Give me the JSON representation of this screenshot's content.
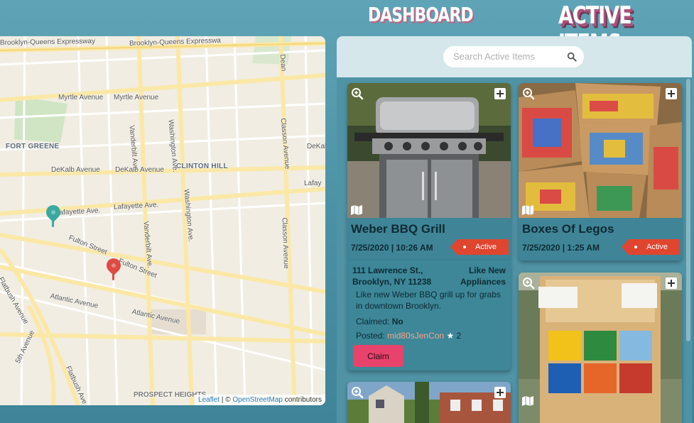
{
  "nav": {
    "dashboard": "DASHBOARD",
    "active_items": "ACTIVE ITEMS"
  },
  "map": {
    "labels": {
      "bqe_1": "Brooklyn-Queens Expressway",
      "bqe_2": "Brooklyn-Queens Expresswa",
      "myrtle_1": "Myrtle Avenue",
      "myrtle_2": "Myrtle Avenue",
      "fort_greene": "FORT GREENE",
      "dekalb_1": "DeKalb Avenue",
      "dekalb_2": "DeKalb Avenue",
      "clinton_hill": "CLINTON HILL",
      "dekalb_3": "DeKalb",
      "lafayette_1": "Lafayette Ave.",
      "lafayette_2": "Lafayette Ave.",
      "lafayette_3": "Lafay",
      "fulton_1": "Fulton Street",
      "fulton_2": "Fulton Street",
      "atlantic_1": "Atlantic Avenue",
      "atlantic_2": "Atlantic Avenue",
      "vanderbilt_1": "Vanderbilt Ave.",
      "vanderbilt_2": "Vanderbilt Ave.",
      "washington_1": "Washington Ave.",
      "washington_2": "Washington Ave.",
      "classon_1": "Classon Avenue",
      "classon_2": "Classon Avenue",
      "flatbush_1": "Flatbush Avenue",
      "flatbush_2": "Flatbush Ave",
      "fifth_ave": "5th Avenue",
      "prospect_heights": "PROSPECT HEIGHTS",
      "dean": "Dean"
    },
    "attribution": {
      "leaflet": "Leaflet",
      "sep": " | © ",
      "osm": "OpenStreetMap",
      "contrib": " contributors"
    },
    "pins": {
      "teal": "#3aa9a0",
      "red": "#e04a44"
    }
  },
  "search": {
    "placeholder": "Search Active Items"
  },
  "cards": [
    {
      "title": "Weber BBQ Grill",
      "date": "7/25/2020 | 10:26 AM",
      "status": "Active",
      "address_line1": "111 Lawrence St.,",
      "address_line2": "Brooklyn, NY 11238",
      "condition_line1": "Like New",
      "condition_line2": "Appliances",
      "description": "Like new Weber BBQ grill up for grabs in downtown Brooklyn.",
      "claimed_label": "Claimed:",
      "claimed_value": "No",
      "posted_label": "Posted:",
      "posted_user": "mid80sJenCon",
      "rating": "2",
      "claim_label": "Claim"
    },
    {
      "title": "Boxes Of Legos",
      "date": "7/25/2020 | 1:25 AM",
      "status": "Active"
    },
    {
      "title": ""
    },
    {
      "title": ""
    }
  ],
  "colors": {
    "accent": "#4a90a4",
    "badge": "#e0452f",
    "claim": "#e8436c"
  }
}
